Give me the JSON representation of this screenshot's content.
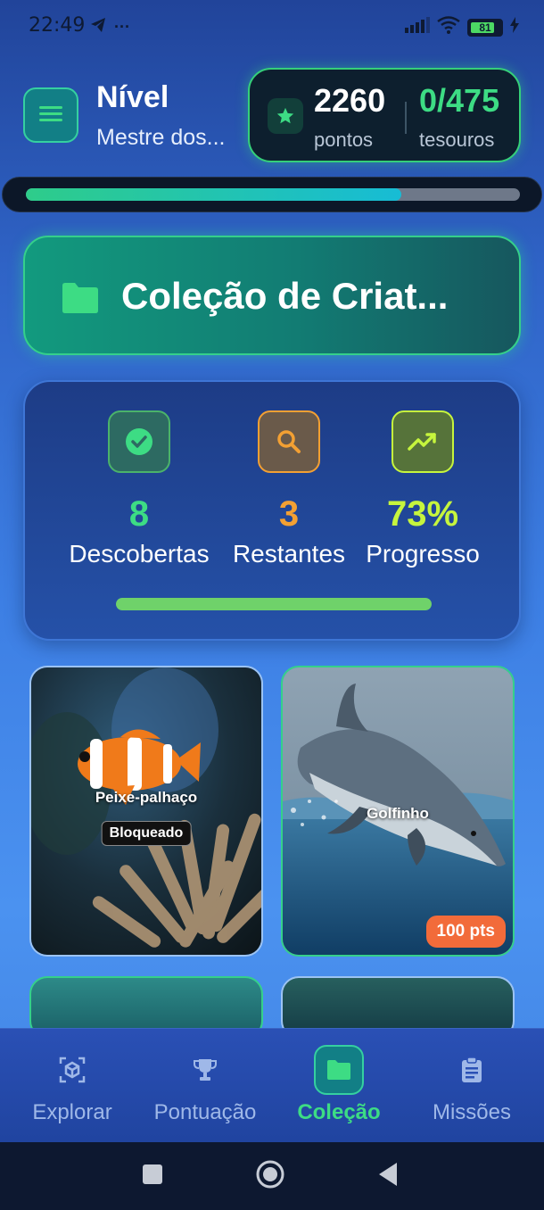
{
  "status_bar": {
    "time": "22:49",
    "battery": "81",
    "battery_fraction": 0.81
  },
  "header": {
    "level_title": "Nível",
    "level_subtitle": "Mestre dos...",
    "points_value": "2260",
    "points_label": "pontos",
    "treasures_value": "0/475",
    "treasures_label": "tesouros",
    "level_progress_fraction": 0.76
  },
  "section": {
    "title": "Coleção de Criat..."
  },
  "stats": {
    "items": [
      {
        "value": "8",
        "label": "Descobertas",
        "color": "#3ddc84",
        "icon": "check-circle-icon"
      },
      {
        "value": "3",
        "label": "Restantes",
        "color": "#f3a033",
        "icon": "search-icon"
      },
      {
        "value": "73%",
        "label": "Progresso",
        "color": "#c6f53d",
        "icon": "trending-up-icon"
      }
    ],
    "progress_fraction": 1.0
  },
  "creatures": [
    {
      "name": "Peixe-palhaço",
      "status": "Bloqueado"
    },
    {
      "name": "Golfinho",
      "points": "100 pts"
    }
  ],
  "bottom_nav": {
    "items": [
      {
        "label": "Explorar",
        "icon": "cube-scan-icon"
      },
      {
        "label": "Pontuação",
        "icon": "trophy-icon"
      },
      {
        "label": "Coleção",
        "icon": "folder-icon",
        "active": true
      },
      {
        "label": "Missões",
        "icon": "clipboard-icon"
      }
    ]
  },
  "colors": {
    "accent_green": "#3ddc84",
    "accent_orange": "#f26b3a",
    "nav_active_bg": "#127f86"
  }
}
